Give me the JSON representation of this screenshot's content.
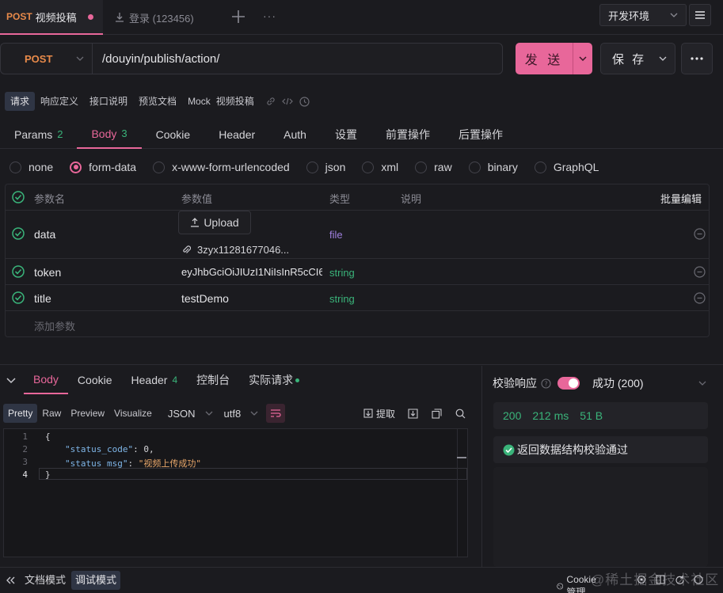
{
  "tabs": [
    {
      "method": "POST",
      "title": "视频投稿",
      "unsaved": true
    },
    {
      "title": "登录 (123456)"
    }
  ],
  "environment": "开发环境",
  "request": {
    "method": "POST",
    "url": "/douyin/publish/action/",
    "send_label": "发 送",
    "save_label": "保 存"
  },
  "subnav": [
    "请求",
    "响应定义",
    "接口说明",
    "预览文档",
    "Mock",
    "视频投稿"
  ],
  "param_tabs": [
    {
      "label": "Params",
      "count": "2"
    },
    {
      "label": "Body",
      "count": "3"
    },
    {
      "label": "Cookie"
    },
    {
      "label": "Header"
    },
    {
      "label": "Auth"
    },
    {
      "label": "设置"
    },
    {
      "label": "前置操作"
    },
    {
      "label": "后置操作"
    }
  ],
  "body_types": [
    "none",
    "form-data",
    "x-www-form-urlencoded",
    "json",
    "xml",
    "raw",
    "binary",
    "GraphQL"
  ],
  "table": {
    "headers": {
      "name": "参数名",
      "value": "参数值",
      "type": "类型",
      "desc": "说明",
      "bulk": "批量编辑"
    },
    "rows": [
      {
        "name": "data",
        "upload": "Upload",
        "file": "3zyx11281677046...",
        "type": "file"
      },
      {
        "name": "token",
        "value": "eyJhbGciOiJIUzI1NiIsInR5cCI6",
        "type": "string"
      },
      {
        "name": "title",
        "value": "testDemo",
        "type": "string"
      }
    ],
    "add_placeholder": "添加参数"
  },
  "response": {
    "tabs": [
      {
        "label": "Body"
      },
      {
        "label": "Cookie"
      },
      {
        "label": "Header",
        "count": "4"
      },
      {
        "label": "控制台"
      },
      {
        "label": "实际请求"
      }
    ],
    "views": [
      "Pretty",
      "Raw",
      "Preview",
      "Visualize"
    ],
    "format": "JSON",
    "encoding": "utf8",
    "extract": "提取",
    "code": {
      "l1": "{",
      "k2": "\"status_code\"",
      "v2": "0",
      "k3": "\"status_msg\"",
      "v3": "\"视频上传成功\"",
      "l4": "}"
    }
  },
  "verify": {
    "label": "校验响应",
    "result": "成功 (200)",
    "status": "200",
    "time": "212 ms",
    "size": "51 B",
    "message": "返回数据结构校验通过"
  },
  "footer": {
    "doc_mode": "文档模式",
    "debug_mode": "调试模式",
    "cookie": "Cookie 管理"
  },
  "watermark": "@稀土掘金技术社区",
  "colors": {
    "accent": "#e8679a",
    "success": "#3ab47a",
    "method": "#e88a4a"
  }
}
